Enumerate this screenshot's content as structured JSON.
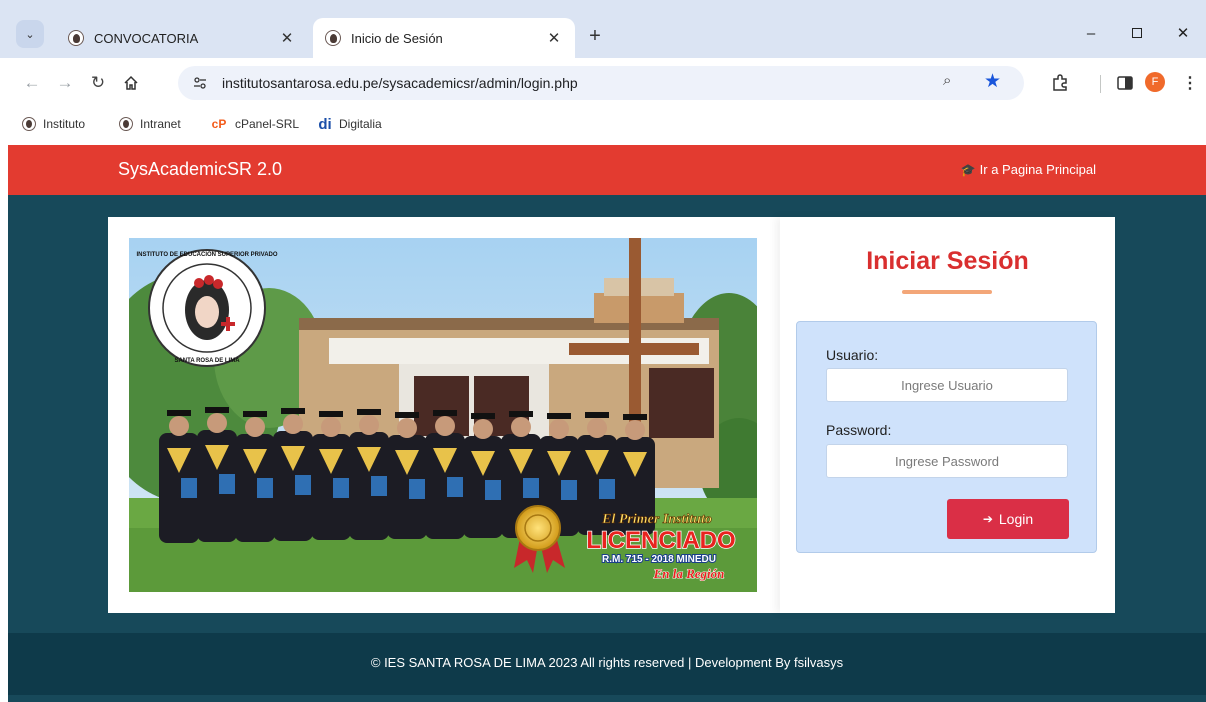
{
  "browser": {
    "tabs": [
      {
        "title": "CONVOCATORIA",
        "active": false
      },
      {
        "title": "Inicio de Sesión",
        "active": true
      }
    ],
    "new_tab_icon": "plus-icon",
    "window_controls": [
      "minimize-icon",
      "maximize-icon",
      "close-icon"
    ],
    "url": "institutosantarosa.edu.pe/sysacademicsr/admin/login.php",
    "profile_initial": "F",
    "profile_color": "#f06a2b",
    "bookmarks": [
      {
        "label": "Instituto",
        "icon": "institute-favicon"
      },
      {
        "label": "Intranet",
        "icon": "institute-favicon"
      },
      {
        "label": "cPanel-SRL",
        "icon": "cpanel-icon"
      },
      {
        "label": "Digitalia",
        "icon": "digitalia-icon"
      }
    ]
  },
  "app": {
    "brand": "SysAcademicSR 2.0",
    "home_link": "Ir a Pagina Principal",
    "header_color": "#e33b30",
    "background_color": "#17495a"
  },
  "banner": {
    "seal_text": "INSTITUTO DE EDUCACIÓN SUPERIOR PRIVADO · SANTA ROSA DE LIMA",
    "line1": "El Primer Instituto",
    "line2": "LICENCIADO",
    "line3": "R.M. 715 - 2018 MINEDU",
    "line4": "En la Región"
  },
  "login": {
    "title": "Iniciar Sesión",
    "username_label": "Usuario:",
    "username_placeholder": "Ingrese Usuario",
    "password_label": "Password:",
    "password_placeholder": "Ingrese Password",
    "button_label": "Login",
    "accent_color": "#da2f46"
  },
  "footer": {
    "text": "© IES SANTA ROSA DE LIMA 2023 All rights reserved | Development By fsilvasys"
  }
}
